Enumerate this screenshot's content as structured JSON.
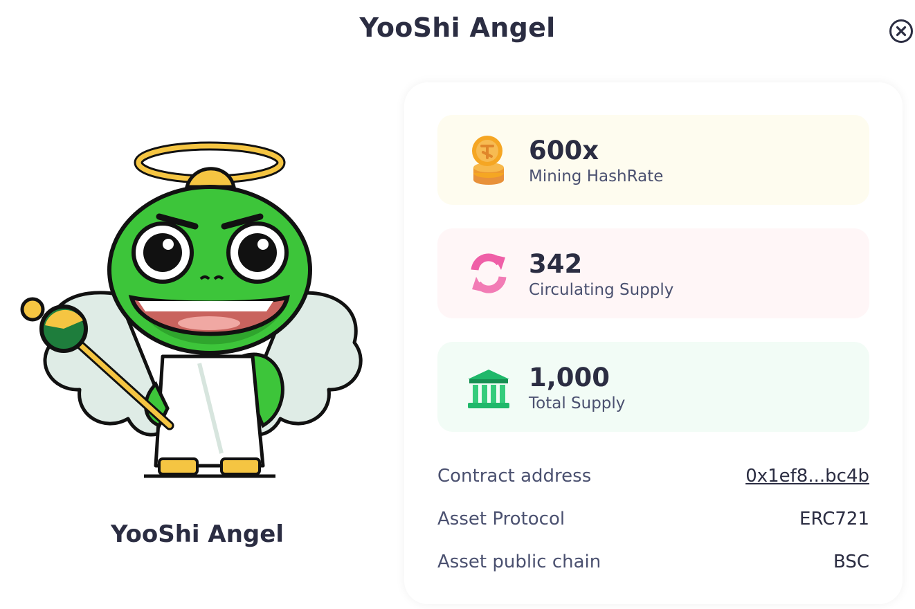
{
  "modal": {
    "title": "YooShi Angel"
  },
  "nft": {
    "name": "YooShi Angel"
  },
  "stats": [
    {
      "value": "600x",
      "label": "Mining HashRate",
      "icon": "coin-stack-icon",
      "bg": "#fefcef"
    },
    {
      "value": "342",
      "label": "Circulating Supply",
      "icon": "refresh-icon",
      "bg": "#fff6f7"
    },
    {
      "value": "1,000",
      "label": "Total Supply",
      "icon": "bank-icon",
      "bg": "#f2fcf6"
    }
  ],
  "properties": [
    {
      "label": "Contract address",
      "value": "0x1ef8...bc4b"
    },
    {
      "label": "Asset Protocol",
      "value": "ERC721"
    },
    {
      "label": "Asset public chain",
      "value": "BSC"
    }
  ],
  "colors": {
    "title": "#2b2d42",
    "muted": "#4b5170",
    "coin": "#f5a623",
    "refresh": "#ef5fa7",
    "bank": "#1fb86a",
    "mascot_green": "#3dc53a"
  }
}
